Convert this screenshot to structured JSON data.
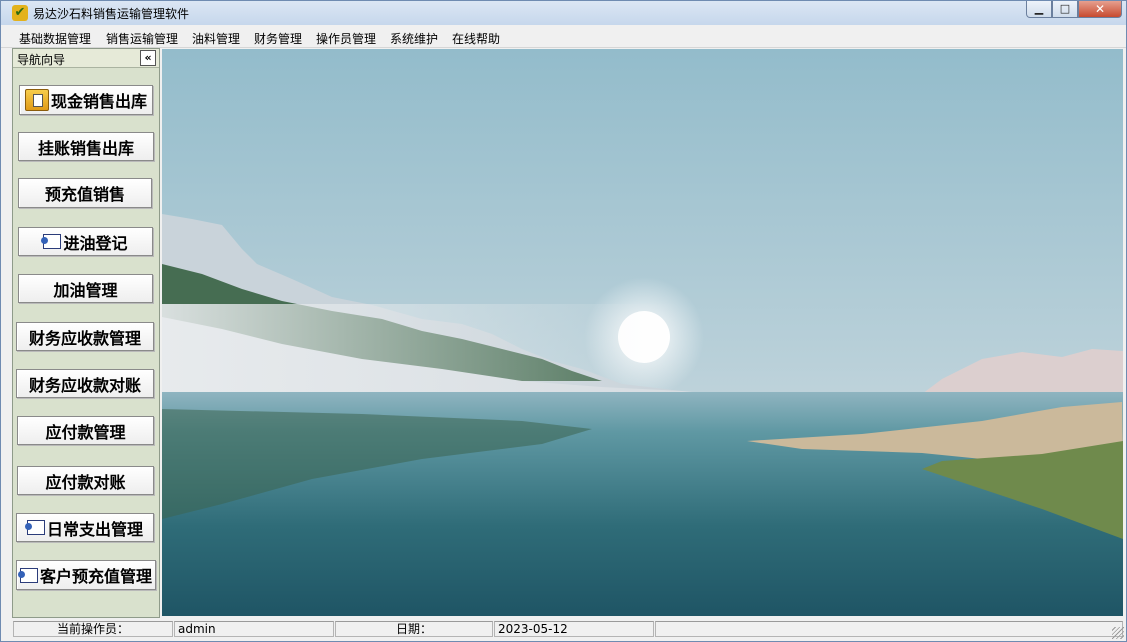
{
  "window": {
    "title": "易达沙石料销售运输管理软件",
    "controls": {
      "minimize": "▁",
      "maximize": "□",
      "close": "✕"
    }
  },
  "menu": [
    {
      "label": "基础数据管理"
    },
    {
      "label": "销售运输管理"
    },
    {
      "label": "油料管理"
    },
    {
      "label": "财务管理"
    },
    {
      "label": "操作员管理"
    },
    {
      "label": "系统维护"
    },
    {
      "label": "在线帮助"
    }
  ],
  "nav": {
    "title": "导航向导",
    "collapse_label": "«",
    "buttons": [
      {
        "label": "现金销售出库",
        "icon": "folder-icon"
      },
      {
        "label": "挂账销售出库",
        "icon": ""
      },
      {
        "label": "预充值销售",
        "icon": ""
      },
      {
        "label": "进油登记",
        "icon": "id-card-icon"
      },
      {
        "label": "加油管理",
        "icon": ""
      },
      {
        "label": "财务应收款管理",
        "icon": ""
      },
      {
        "label": "财务应收款对账",
        "icon": ""
      },
      {
        "label": "应付款管理",
        "icon": ""
      },
      {
        "label": "应付款对账",
        "icon": ""
      },
      {
        "label": "日常支出管理",
        "icon": "id-card-icon"
      },
      {
        "label": "客户预充值管理",
        "icon": "id-card-icon"
      }
    ]
  },
  "status": {
    "operator_label": "当前操作员：",
    "operator_value": "admin",
    "date_label": "日期：",
    "date_value": "2023-05-12"
  },
  "colors": {
    "sky_top": "#93bccb",
    "sky_horizon": "#d9dde1",
    "water": "#2f6c78",
    "title_bar": "#c6d7ec",
    "nav_bg": "#d9e1cd"
  }
}
